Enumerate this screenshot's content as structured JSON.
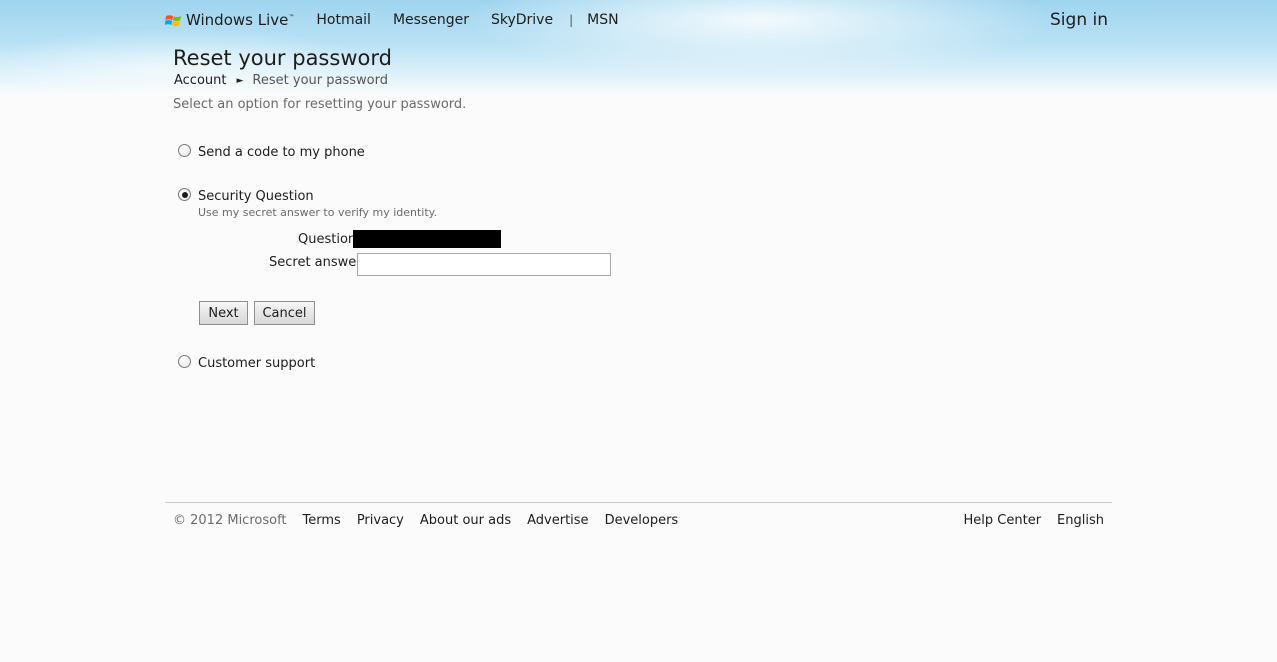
{
  "header": {
    "brand_name": "Windows Live",
    "brand_tm": "™",
    "nav": [
      "Hotmail",
      "Messenger",
      "SkyDrive",
      "MSN"
    ],
    "separator": "|",
    "signin_label": "Sign in"
  },
  "main": {
    "title": "Reset your password",
    "breadcrumb": {
      "parent": "Account",
      "arrow": "►",
      "current": "Reset your password"
    },
    "instruction": "Select an option for resetting your password.",
    "options": [
      {
        "label": "Send a code to my phone",
        "selected": false
      },
      {
        "label": "Security Question",
        "description": "Use my secret answer to verify my identity.",
        "selected": true
      },
      {
        "label": "Customer support",
        "selected": false
      }
    ],
    "security_form": {
      "question_label": "Question:",
      "answer_label": "Secret answer:",
      "answer_value": ""
    },
    "buttons": {
      "next": "Next",
      "cancel": "Cancel"
    }
  },
  "footer": {
    "copyright": "© 2012 Microsoft",
    "links": [
      "Terms",
      "Privacy",
      "About our ads",
      "Advertise",
      "Developers"
    ],
    "right_links": [
      "Help Center",
      "English"
    ]
  },
  "colors": {
    "header_sky": "#9fd4ef",
    "background": "#fbfbfb",
    "muted_text": "#6b6b6b",
    "redaction": "#000000"
  }
}
